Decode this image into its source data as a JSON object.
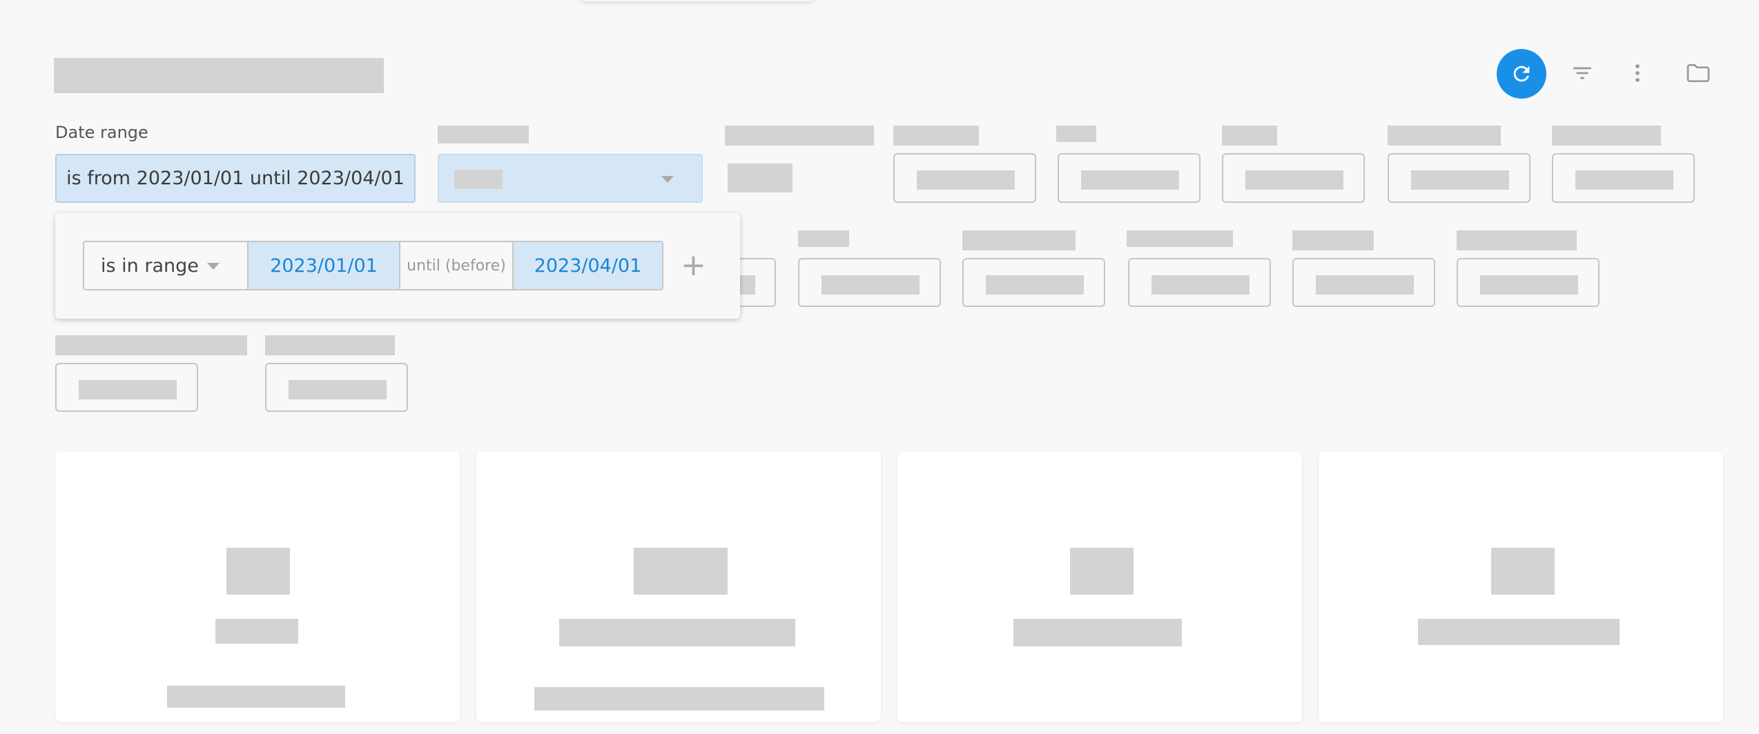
{
  "toolbar": {
    "refresh_icon": "refresh-icon",
    "filter_icon": "filter-icon",
    "more_icon": "more-vertical-icon",
    "folder_icon": "folder-icon",
    "accent_color": "#1a8fe8"
  },
  "filters": {
    "date_range": {
      "label": "Date range",
      "summary": "is from 2023/01/01 until 2023/04/01"
    },
    "range_editor": {
      "operator": "is in range",
      "start": "2023/01/01",
      "separator": "until (before)",
      "end": "2023/04/01",
      "add_symbol": "+"
    }
  }
}
